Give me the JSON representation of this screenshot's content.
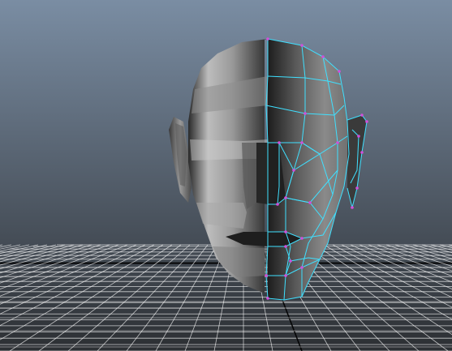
{
  "viewport": {
    "background_top": "#7a8da3",
    "background_bottom": "#2c2f33",
    "grid_color": "#ffffff",
    "axis_color": "#000000",
    "wireframe_color": "#3fe0ff",
    "vertex_color": "#d14fd9",
    "mesh_light": "#d0d0d0",
    "mesh_mid": "#808080",
    "mesh_dark": "#1e1e1e"
  },
  "scene": {
    "object": "head-mesh",
    "view": "perspective",
    "mirrored_half_selected": true
  }
}
